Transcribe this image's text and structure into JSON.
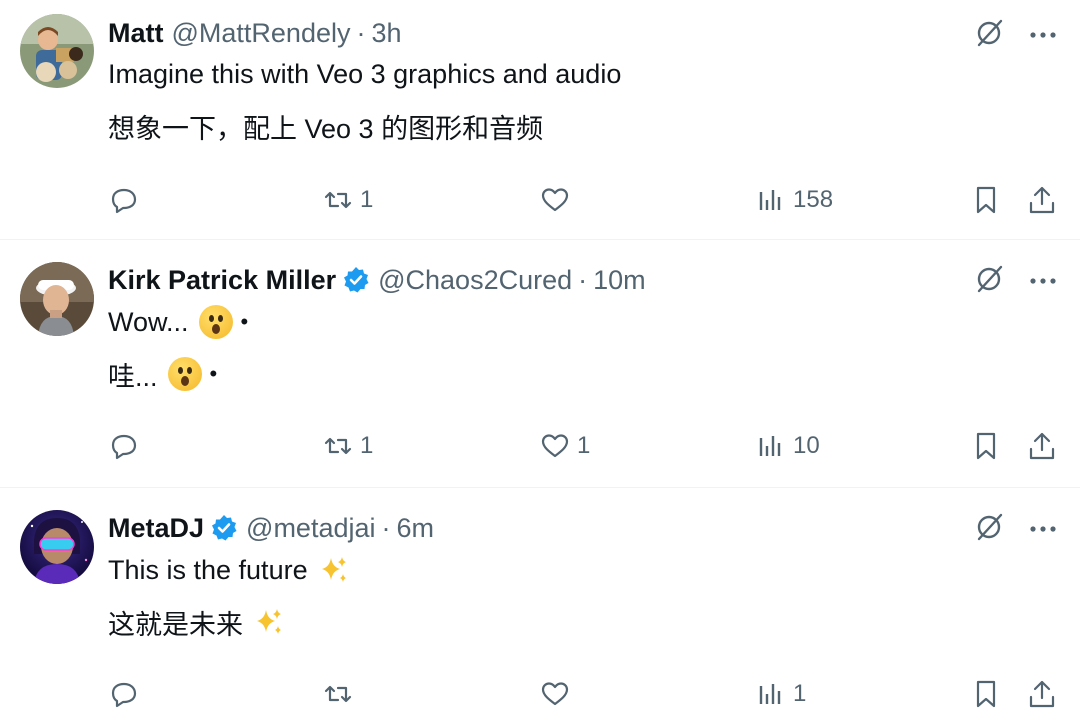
{
  "tweets": [
    {
      "name": "Matt",
      "handle": "@MattRendely",
      "separator": "·",
      "time": "3h",
      "verified": false,
      "line1": "Imagine this with Veo 3 graphics and audio",
      "line2": "想象一下，配上 Veo 3 的图形和音频",
      "line1_emoji": "",
      "line2_emoji": "",
      "counts": {
        "replies": "",
        "retweets": "1",
        "likes": "",
        "views": "158"
      }
    },
    {
      "name": "Kirk Patrick Miller",
      "handle": "@Chaos2Cured",
      "separator": "·",
      "time": "10m",
      "verified": true,
      "line1": "Wow...",
      "line2": "哇...",
      "line1_emoji": "astonished-face",
      "line2_emoji": "astonished-face",
      "trailing_dot": "•",
      "counts": {
        "replies": "",
        "retweets": "1",
        "likes": "1",
        "views": "10"
      }
    },
    {
      "name": "MetaDJ",
      "handle": "@metadjai",
      "separator": "·",
      "time": "6m",
      "verified": true,
      "line1": "This is the future",
      "line2": "这就是未来",
      "line1_emoji": "sparkles",
      "line2_emoji": "sparkles",
      "counts": {
        "replies": "",
        "retweets": "",
        "likes": "",
        "views": "1"
      }
    }
  ],
  "colors": {
    "text": "#0f1419",
    "secondary": "#536471",
    "verified_blue": "#1d9bf0",
    "divider": "#eff3f4"
  },
  "icons": {
    "top_right": [
      "grok-slash-icon",
      "more-icon"
    ],
    "actions": [
      "reply-icon",
      "retweet-icon",
      "like-icon",
      "views-icon",
      "bookmark-icon",
      "share-icon"
    ]
  }
}
